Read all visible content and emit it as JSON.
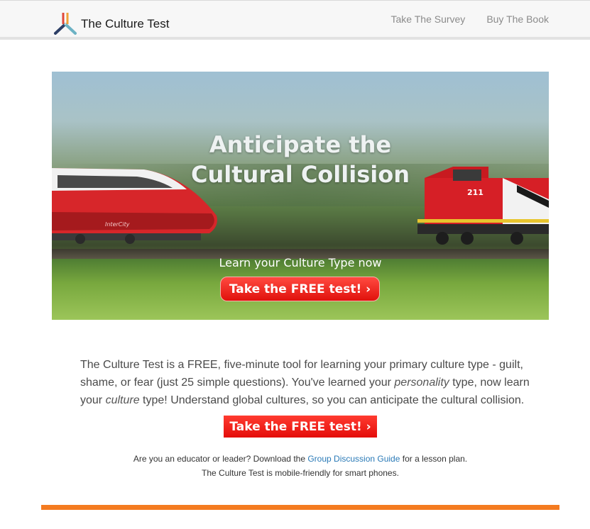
{
  "header": {
    "logo_text": "The Culture Test",
    "nav": [
      {
        "label": "Take The Survey"
      },
      {
        "label": "Buy The Book"
      }
    ]
  },
  "hero": {
    "headline_line1": "Anticipate the",
    "headline_line2": "Cultural Collision",
    "subtitle": "Learn your Culture Type now",
    "cta_label": "Take the FREE test! ›",
    "train_number": "211",
    "train_brand": "InterCity"
  },
  "intro": {
    "part1": "The Culture Test is a FREE, five-minute tool for learning your primary culture type - guilt, shame, or fear (just 25 simple questions). You've learned your ",
    "em1": "personality",
    "part2": " type, now learn your ",
    "em2": "culture",
    "part3": " type! Understand global cultures, so you can anticipate the cultural collision."
  },
  "cta": {
    "label": "Take the FREE test! ›"
  },
  "notes": {
    "line1_before": "Are you an educator or leader? Download the ",
    "line1_link": "Group Discussion Guide",
    "line1_after": " for a lesson plan.",
    "line2": "The Culture Test is mobile-friendly for smart phones."
  },
  "colors": {
    "accent_red": "#e40d0a",
    "footer_orange": "#f47b20",
    "link_blue": "#2a7ab7"
  },
  "icons": [
    "logo-tripod-icon",
    "chevron-right-icon"
  ]
}
